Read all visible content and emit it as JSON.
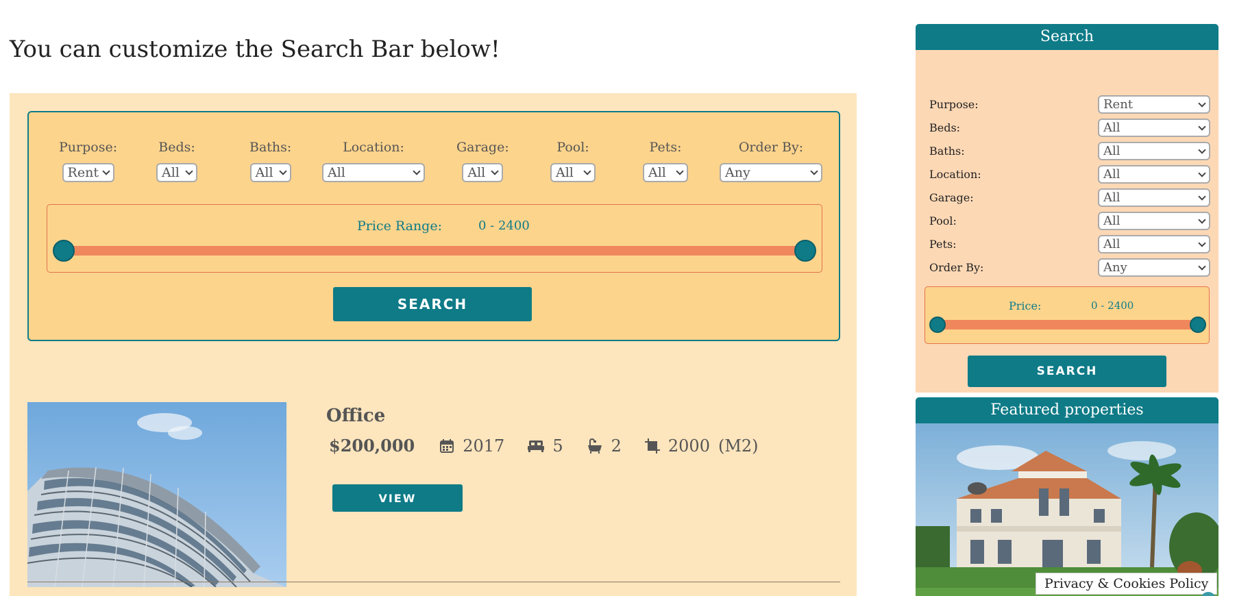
{
  "page": {
    "heading": "You can customize the Search Bar below!"
  },
  "search": {
    "fields": [
      {
        "label": "Purpose:",
        "value": "Rent"
      },
      {
        "label": "Beds:",
        "value": "All"
      },
      {
        "label": "Baths:",
        "value": "All"
      },
      {
        "label": "Location:",
        "value": "All"
      },
      {
        "label": "Garage:",
        "value": "All"
      },
      {
        "label": "Pool:",
        "value": "All"
      },
      {
        "label": "Pets:",
        "value": "All"
      },
      {
        "label": "Order By:",
        "value": "Any"
      }
    ],
    "price_label": "Price Range:",
    "price_value": "0 - 2400",
    "price_min": 0,
    "price_max": 2400,
    "button_label": "SEARCH"
  },
  "property": {
    "title": "Office",
    "price": "$200,000",
    "year": "2017",
    "beds": "5",
    "baths": "2",
    "area": "2000",
    "area_unit": "(M2)",
    "view_label": "VIEW"
  },
  "sidebar": {
    "search_title": "Search",
    "fields": [
      {
        "label": "Purpose:",
        "value": "Rent"
      },
      {
        "label": "Beds:",
        "value": "All"
      },
      {
        "label": "Baths:",
        "value": "All"
      },
      {
        "label": "Location:",
        "value": "All"
      },
      {
        "label": "Garage:",
        "value": "All"
      },
      {
        "label": "Pool:",
        "value": "All"
      },
      {
        "label": "Pets:",
        "value": "All"
      },
      {
        "label": "Order By:",
        "value": "Any"
      }
    ],
    "price_label": "Price:",
    "price_value": "0 - 2400",
    "button_label": "SEARCH",
    "featured_title": "Featured properties"
  },
  "footer": {
    "privacy_label": "Privacy & Cookies Policy"
  },
  "colors": {
    "teal": "#0e7b87",
    "orange": "#f0875c",
    "panel": "#fde5bd",
    "search_bg": "#fdd48c"
  }
}
